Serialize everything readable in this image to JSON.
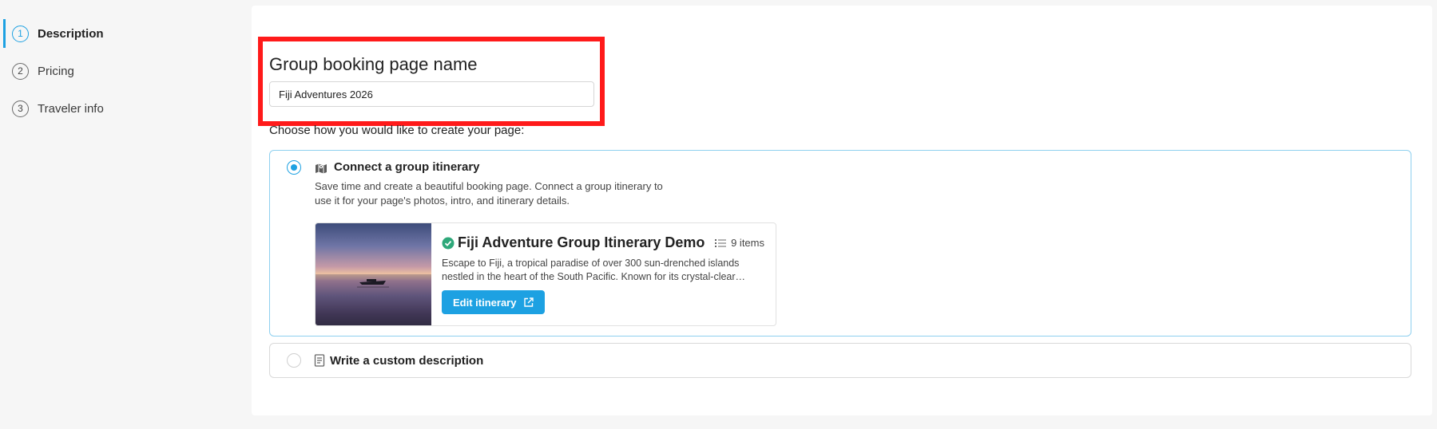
{
  "sidebar": {
    "steps": [
      {
        "number": "1",
        "label": "Description",
        "active": true
      },
      {
        "number": "2",
        "label": "Pricing",
        "active": false
      },
      {
        "number": "3",
        "label": "Traveler info",
        "active": false
      }
    ]
  },
  "form": {
    "section_title": "Group booking page name",
    "name_value": "Fiji Adventures 2026",
    "choose_label": "Choose how you would like to create your page:"
  },
  "options": {
    "connect": {
      "title": "Connect a group itinerary",
      "selected": true,
      "description": "Save time and create a beautiful booking page. Connect a group itinerary to use it for your page's photos, intro, and itinerary details."
    },
    "custom": {
      "title": "Write a custom description",
      "selected": false
    }
  },
  "itinerary": {
    "title": "Fiji Adventure Group Itinerary Demo",
    "items_count": "9 items",
    "description": "Escape to Fiji, a tropical paradise of over 300 sun-drenched islands nestled in the heart of the South Pacific. Known for its crystal-clear…",
    "edit_label": "Edit itinerary"
  },
  "colors": {
    "accent": "#1da1e2",
    "highlight": "#ff1a1a",
    "check": "#2ea87a"
  }
}
